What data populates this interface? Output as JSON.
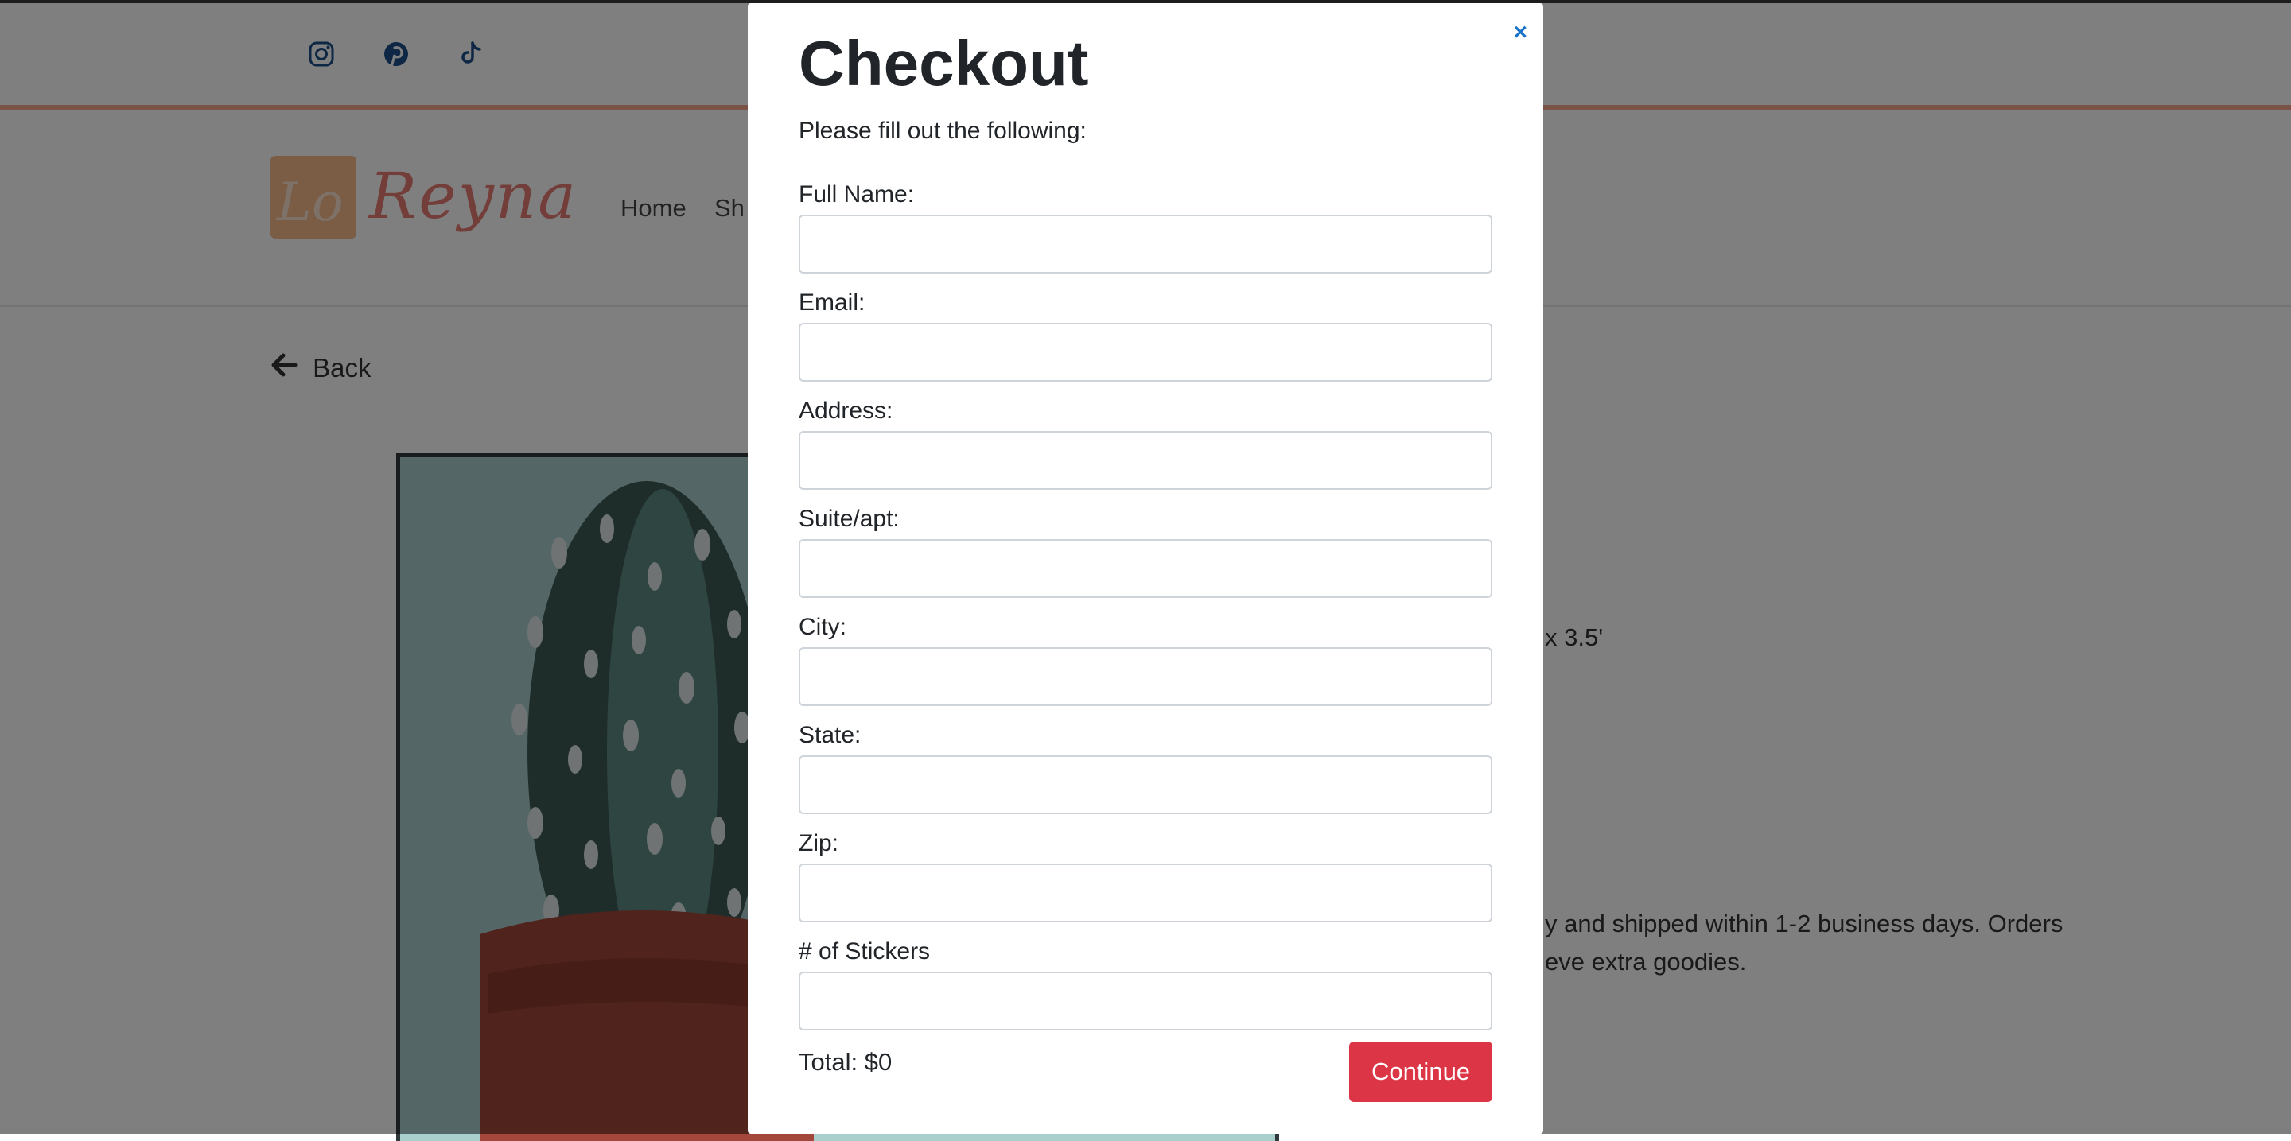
{
  "site": {
    "social": [
      {
        "icon": "instagram-icon"
      },
      {
        "icon": "pinterest-icon"
      },
      {
        "icon": "tiktok-icon"
      }
    ],
    "nav": {
      "links": [
        "Home",
        "Sh"
      ]
    },
    "back_label": "Back",
    "product": {
      "size_text": "x 3.5'",
      "shipping_line_1": "y and shipped within 1-2 business days. Orders",
      "shipping_line_2": "eve extra goodies."
    }
  },
  "checkout": {
    "title": "Checkout",
    "close_label": "×",
    "subtitle": "Please fill out the following:",
    "fields": [
      {
        "label": "Full Name:",
        "value": ""
      },
      {
        "label": "Email:",
        "value": ""
      },
      {
        "label": "Address:",
        "value": ""
      },
      {
        "label": "Suite/apt:",
        "value": ""
      },
      {
        "label": "City:",
        "value": ""
      },
      {
        "label": "State:",
        "value": ""
      },
      {
        "label": "Zip:",
        "value": ""
      },
      {
        "label": "# of Stickers",
        "value": ""
      }
    ],
    "total_label": "Total: $0",
    "continue_label": "Continue"
  },
  "colors": {
    "accent_red": "#dc3545",
    "close_blue": "#1a73c9",
    "divider_peach": "#f4a58c",
    "logo_pink": "#e77d72"
  }
}
